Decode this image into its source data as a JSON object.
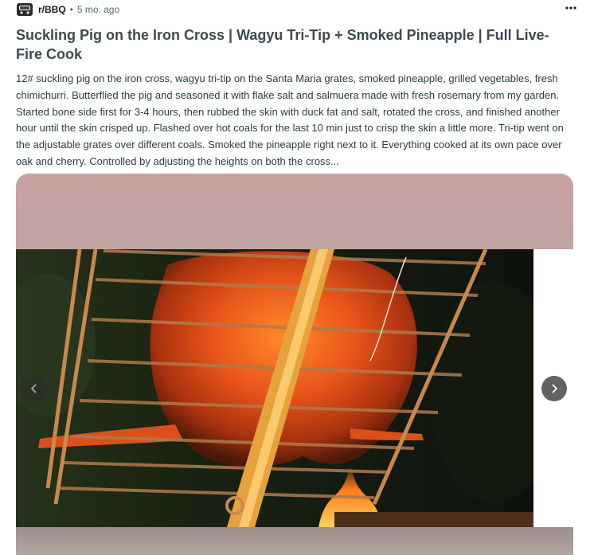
{
  "post": {
    "subreddit": "r/BBQ",
    "separator": "•",
    "age": "5 mo. ago",
    "title": "Suckling Pig on the Iron Cross | Wagyu Tri-Tip + Smoked Pineapple | Full Live-Fire Cook",
    "body": "12# suckling pig on the iron cross, wagyu tri-tip on the Santa Maria grates, smoked pineapple, grilled vegetables, fresh chimichurri. Butterflied the pig and seasoned it with flake salt and salmuera made with fresh rosemary from my garden. Started bone side first for 3-4 hours, then rubbed the skin with duck fat and salt, rotated the cross, and finished another hour until the skin crisped up. Flashed over hot coals for the last 10 min just to crisp the skin a little more. Tri-tip went on the adjustable grates over different coals. Smoked the pineapple right next to it. Everything cooked at its own pace over oak and cherry. Controlled by adjusting the heights on both the cross..."
  },
  "icons": {
    "avatar": "grill-icon",
    "more": "more-options-icon",
    "prev": "chevron-left-icon",
    "next": "chevron-right-icon"
  },
  "colors": {
    "title": "#3f4a4f",
    "body": "#2a3c42",
    "meta": "#576f76",
    "fire": "#e8541a"
  }
}
